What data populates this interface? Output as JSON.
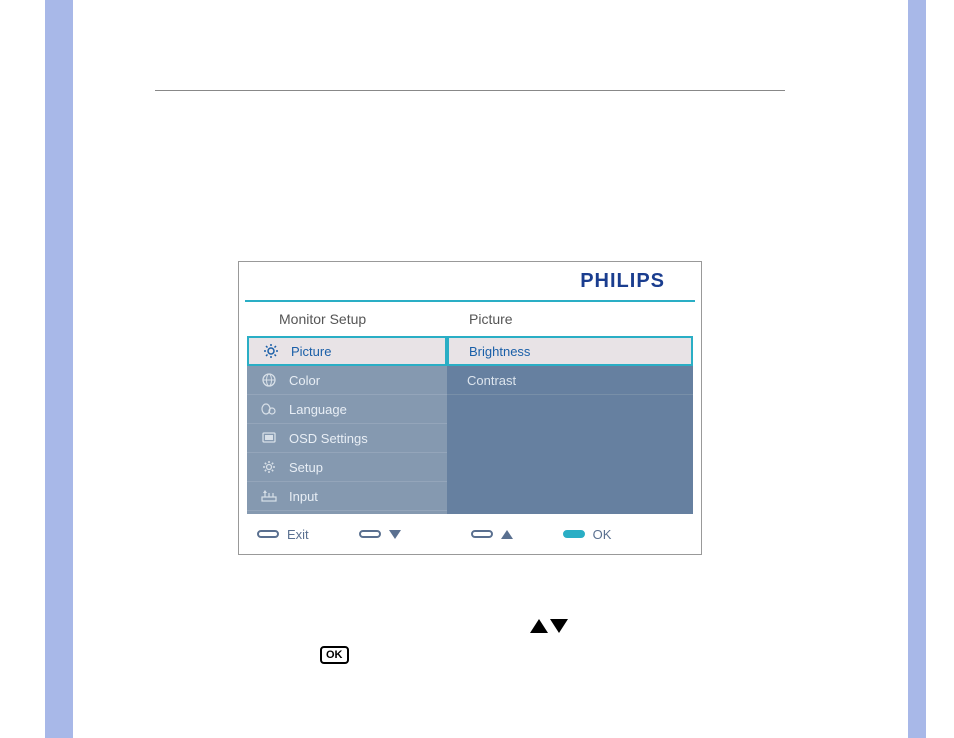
{
  "brand": "PHILIPS",
  "titles": {
    "left": "Monitor Setup",
    "right": "Picture"
  },
  "menuLeft": [
    {
      "label": "Picture",
      "selected": true,
      "icon": "sun"
    },
    {
      "label": "Color",
      "selected": false,
      "icon": "globe"
    },
    {
      "label": "Language",
      "selected": false,
      "icon": "lang"
    },
    {
      "label": "OSD Settings",
      "selected": false,
      "icon": "screen"
    },
    {
      "label": "Setup",
      "selected": false,
      "icon": "gear"
    },
    {
      "label": "Input",
      "selected": false,
      "icon": "input"
    }
  ],
  "menuRight": [
    {
      "label": "Brightness",
      "selected": true
    },
    {
      "label": "Contrast",
      "selected": false
    }
  ],
  "footer": {
    "exit": "Exit",
    "ok": "OK"
  },
  "instruction": {
    "okLabel": "OK"
  }
}
